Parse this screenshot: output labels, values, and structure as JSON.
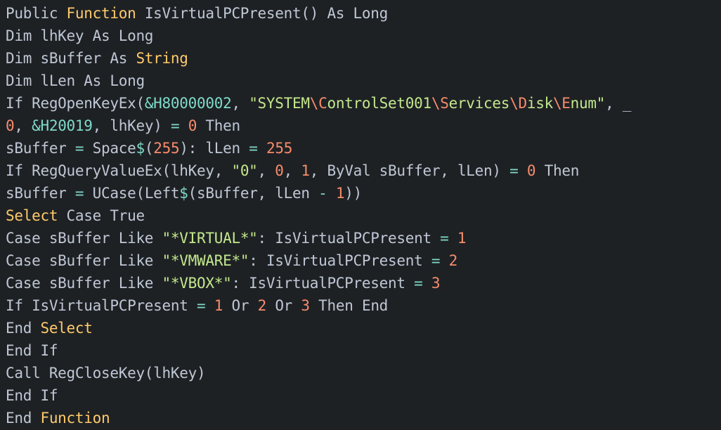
{
  "editor": {
    "language": "Visual Basic",
    "background_color": "#1e2124",
    "default_text_color": "#bfc7d5",
    "keyword_color": "#ffcb6b",
    "string_color": "#c3e88d",
    "number_color": "#f78c6c",
    "escape_color": "#f78c6c",
    "operator_color": "#7fdbca",
    "line_count": 18,
    "font_size_px": 21,
    "line_height_px": 32
  },
  "code": {
    "plain_text": "Public Function IsVirtualPCPresent() As Long\nDim lhKey As Long\nDim sBuffer As String\nDim lLen As Long\nIf RegOpenKeyEx(&H80000002, \"SYSTEM\\ControlSet001\\Services\\Disk\\Enum\", _\n0, &H20019, lhKey) = 0 Then\nsBuffer = Space$(255): lLen = 255\nIf RegQueryValueEx(lhKey, \"0\", 0, 1, ByVal sBuffer, lLen) = 0 Then\nsBuffer = UCase(Left$(sBuffer, lLen - 1))\nSelect Case True\nCase sBuffer Like \"*VIRTUAL*\": IsVirtualPCPresent = 1\nCase sBuffer Like \"*VMWARE*\": IsVirtualPCPresent = 2\nCase sBuffer Like \"*VBOX*\": IsVirtualPCPresent = 3\nIf IsVirtualPCPresent = 1 Or 2 Or 3 Then End\nEnd Select\nEnd If\nCall RegCloseKey(lhKey)\nEnd If\nEnd Function",
    "lines": [
      {
        "number": 1,
        "text": "Public Function IsVirtualPCPresent() As Long",
        "tokens": [
          {
            "t": "Public ",
            "c": "plain"
          },
          {
            "t": "Function",
            "c": "keyword"
          },
          {
            "t": " IsVirtualPCPresent() As Long",
            "c": "plain"
          }
        ]
      },
      {
        "number": 2,
        "text": "Dim lhKey As Long",
        "tokens": [
          {
            "t": "Dim lhKey As Long",
            "c": "plain"
          }
        ]
      },
      {
        "number": 3,
        "text": "Dim sBuffer As String",
        "tokens": [
          {
            "t": "Dim sBuffer As ",
            "c": "plain"
          },
          {
            "t": "String",
            "c": "keyword"
          }
        ]
      },
      {
        "number": 4,
        "text": "Dim lLen As Long",
        "tokens": [
          {
            "t": "Dim lLen As Long",
            "c": "plain"
          }
        ]
      },
      {
        "number": 5,
        "text": "If RegOpenKeyEx(&H80000002, \"SYSTEM\\ControlSet001\\Services\\Disk\\Enum\", _",
        "tokens": [
          {
            "t": "If RegOpenKeyEx(",
            "c": "plain"
          },
          {
            "t": "&H80000002",
            "c": "hex"
          },
          {
            "t": ", ",
            "c": "plain"
          },
          {
            "t": "\"SYSTEM",
            "c": "string"
          },
          {
            "t": "\\C",
            "c": "escape"
          },
          {
            "t": "ontrolSet001",
            "c": "string"
          },
          {
            "t": "\\S",
            "c": "escape"
          },
          {
            "t": "ervices",
            "c": "string"
          },
          {
            "t": "\\D",
            "c": "escape"
          },
          {
            "t": "isk",
            "c": "string"
          },
          {
            "t": "\\E",
            "c": "escape"
          },
          {
            "t": "num\"",
            "c": "string"
          },
          {
            "t": ", _",
            "c": "plain"
          }
        ]
      },
      {
        "number": 6,
        "text": "0, &H20019, lhKey) = 0 Then",
        "tokens": [
          {
            "t": "0",
            "c": "number"
          },
          {
            "t": ", ",
            "c": "plain"
          },
          {
            "t": "&H20019",
            "c": "hex"
          },
          {
            "t": ", lhKey) ",
            "c": "plain"
          },
          {
            "t": "=",
            "c": "operator"
          },
          {
            "t": " ",
            "c": "plain"
          },
          {
            "t": "0",
            "c": "number"
          },
          {
            "t": " Then",
            "c": "plain"
          }
        ]
      },
      {
        "number": 7,
        "text": "sBuffer = Space$(255): lLen = 255",
        "tokens": [
          {
            "t": "sBuffer ",
            "c": "plain"
          },
          {
            "t": "=",
            "c": "operator"
          },
          {
            "t": " Space",
            "c": "plain"
          },
          {
            "t": "$",
            "c": "operator"
          },
          {
            "t": "(",
            "c": "plain"
          },
          {
            "t": "255",
            "c": "number"
          },
          {
            "t": "): lLen ",
            "c": "plain"
          },
          {
            "t": "=",
            "c": "operator"
          },
          {
            "t": " ",
            "c": "plain"
          },
          {
            "t": "255",
            "c": "number"
          }
        ]
      },
      {
        "number": 8,
        "text": "If RegQueryValueEx(lhKey, \"0\", 0, 1, ByVal sBuffer, lLen) = 0 Then",
        "tokens": [
          {
            "t": "If RegQueryValueEx(lhKey, ",
            "c": "plain"
          },
          {
            "t": "\"0\"",
            "c": "string"
          },
          {
            "t": ", ",
            "c": "plain"
          },
          {
            "t": "0",
            "c": "number"
          },
          {
            "t": ", ",
            "c": "plain"
          },
          {
            "t": "1",
            "c": "number"
          },
          {
            "t": ", ByVal sBuffer, lLen) ",
            "c": "plain"
          },
          {
            "t": "=",
            "c": "operator"
          },
          {
            "t": " ",
            "c": "plain"
          },
          {
            "t": "0",
            "c": "number"
          },
          {
            "t": " Then",
            "c": "plain"
          }
        ]
      },
      {
        "number": 9,
        "text": "sBuffer = UCase(Left$(sBuffer, lLen - 1))",
        "tokens": [
          {
            "t": "sBuffer ",
            "c": "plain"
          },
          {
            "t": "=",
            "c": "operator"
          },
          {
            "t": " UCase(Left",
            "c": "plain"
          },
          {
            "t": "$",
            "c": "operator"
          },
          {
            "t": "(sBuffer, lLen ",
            "c": "plain"
          },
          {
            "t": "-",
            "c": "operator"
          },
          {
            "t": " ",
            "c": "plain"
          },
          {
            "t": "1",
            "c": "number"
          },
          {
            "t": "))",
            "c": "plain"
          }
        ]
      },
      {
        "number": 10,
        "text": "Select Case True",
        "tokens": [
          {
            "t": "Select",
            "c": "keyword"
          },
          {
            "t": " Case True",
            "c": "plain"
          }
        ]
      },
      {
        "number": 11,
        "text": "Case sBuffer Like \"*VIRTUAL*\": IsVirtualPCPresent = 1",
        "tokens": [
          {
            "t": "Case sBuffer Like ",
            "c": "plain"
          },
          {
            "t": "\"*VIRTUAL*\"",
            "c": "string"
          },
          {
            "t": ": IsVirtualPCPresent ",
            "c": "plain"
          },
          {
            "t": "=",
            "c": "operator"
          },
          {
            "t": " ",
            "c": "plain"
          },
          {
            "t": "1",
            "c": "number"
          }
        ]
      },
      {
        "number": 12,
        "text": "Case sBuffer Like \"*VMWARE*\": IsVirtualPCPresent = 2",
        "tokens": [
          {
            "t": "Case sBuffer Like ",
            "c": "plain"
          },
          {
            "t": "\"*VMWARE*\"",
            "c": "string"
          },
          {
            "t": ": IsVirtualPCPresent ",
            "c": "plain"
          },
          {
            "t": "=",
            "c": "operator"
          },
          {
            "t": " ",
            "c": "plain"
          },
          {
            "t": "2",
            "c": "number"
          }
        ]
      },
      {
        "number": 13,
        "text": "Case sBuffer Like \"*VBOX*\": IsVirtualPCPresent = 3",
        "tokens": [
          {
            "t": "Case sBuffer Like ",
            "c": "plain"
          },
          {
            "t": "\"*VBOX*\"",
            "c": "string"
          },
          {
            "t": ": IsVirtualPCPresent ",
            "c": "plain"
          },
          {
            "t": "=",
            "c": "operator"
          },
          {
            "t": " ",
            "c": "plain"
          },
          {
            "t": "3",
            "c": "number"
          }
        ]
      },
      {
        "number": 14,
        "text": "If IsVirtualPCPresent = 1 Or 2 Or 3 Then End",
        "tokens": [
          {
            "t": "If IsVirtualPCPresent ",
            "c": "plain"
          },
          {
            "t": "=",
            "c": "operator"
          },
          {
            "t": " ",
            "c": "plain"
          },
          {
            "t": "1",
            "c": "number"
          },
          {
            "t": " Or ",
            "c": "plain"
          },
          {
            "t": "2",
            "c": "number"
          },
          {
            "t": " Or ",
            "c": "plain"
          },
          {
            "t": "3",
            "c": "number"
          },
          {
            "t": " Then End",
            "c": "plain"
          }
        ]
      },
      {
        "number": 15,
        "text": "End Select",
        "tokens": [
          {
            "t": "End ",
            "c": "plain"
          },
          {
            "t": "Select",
            "c": "keyword"
          }
        ]
      },
      {
        "number": 16,
        "text": "End If",
        "tokens": [
          {
            "t": "End If",
            "c": "plain"
          }
        ]
      },
      {
        "number": 17,
        "text": "Call RegCloseKey(lhKey)",
        "tokens": [
          {
            "t": "Call RegCloseKey(lhKey)",
            "c": "plain"
          }
        ]
      },
      {
        "number": 18,
        "text": "End If",
        "tokens": [
          {
            "t": "End If",
            "c": "plain"
          }
        ]
      },
      {
        "number": 19,
        "text": "End Function",
        "tokens": [
          {
            "t": "End ",
            "c": "plain"
          },
          {
            "t": "Function",
            "c": "keyword"
          }
        ]
      }
    ]
  }
}
